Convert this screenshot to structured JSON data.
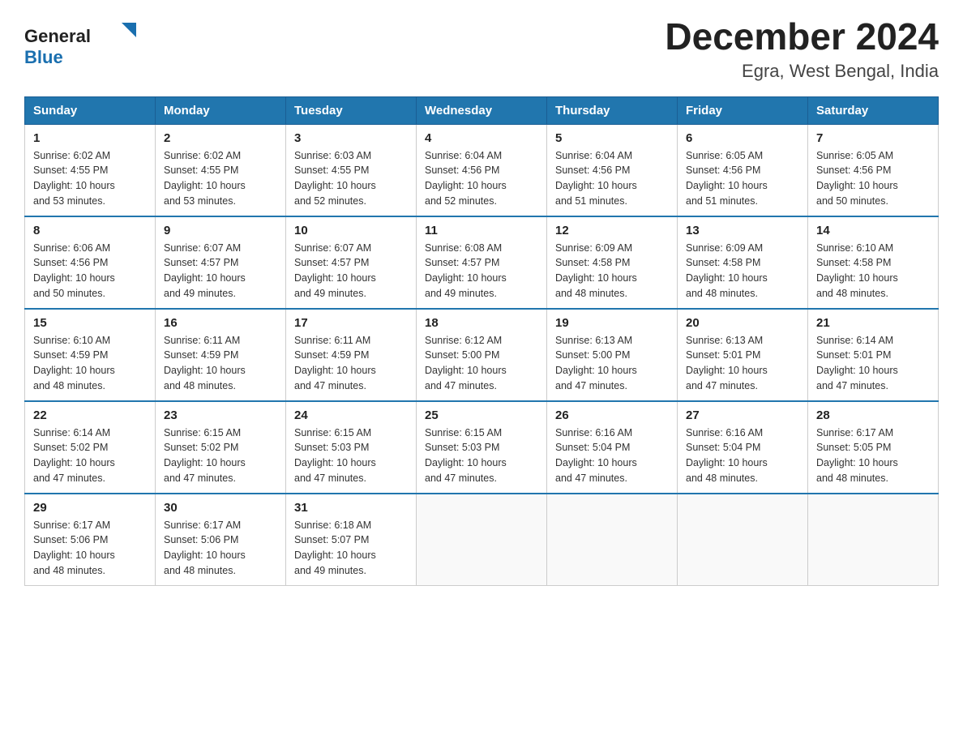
{
  "header": {
    "logo_general": "General",
    "logo_blue": "Blue",
    "month_title": "December 2024",
    "location": "Egra, West Bengal, India"
  },
  "days_of_week": [
    "Sunday",
    "Monday",
    "Tuesday",
    "Wednesday",
    "Thursday",
    "Friday",
    "Saturday"
  ],
  "weeks": [
    [
      {
        "day": "1",
        "sunrise": "6:02 AM",
        "sunset": "4:55 PM",
        "daylight": "10 hours and 53 minutes."
      },
      {
        "day": "2",
        "sunrise": "6:02 AM",
        "sunset": "4:55 PM",
        "daylight": "10 hours and 53 minutes."
      },
      {
        "day": "3",
        "sunrise": "6:03 AM",
        "sunset": "4:55 PM",
        "daylight": "10 hours and 52 minutes."
      },
      {
        "day": "4",
        "sunrise": "6:04 AM",
        "sunset": "4:56 PM",
        "daylight": "10 hours and 52 minutes."
      },
      {
        "day": "5",
        "sunrise": "6:04 AM",
        "sunset": "4:56 PM",
        "daylight": "10 hours and 51 minutes."
      },
      {
        "day": "6",
        "sunrise": "6:05 AM",
        "sunset": "4:56 PM",
        "daylight": "10 hours and 51 minutes."
      },
      {
        "day": "7",
        "sunrise": "6:05 AM",
        "sunset": "4:56 PM",
        "daylight": "10 hours and 50 minutes."
      }
    ],
    [
      {
        "day": "8",
        "sunrise": "6:06 AM",
        "sunset": "4:56 PM",
        "daylight": "10 hours and 50 minutes."
      },
      {
        "day": "9",
        "sunrise": "6:07 AM",
        "sunset": "4:57 PM",
        "daylight": "10 hours and 49 minutes."
      },
      {
        "day": "10",
        "sunrise": "6:07 AM",
        "sunset": "4:57 PM",
        "daylight": "10 hours and 49 minutes."
      },
      {
        "day": "11",
        "sunrise": "6:08 AM",
        "sunset": "4:57 PM",
        "daylight": "10 hours and 49 minutes."
      },
      {
        "day": "12",
        "sunrise": "6:09 AM",
        "sunset": "4:58 PM",
        "daylight": "10 hours and 48 minutes."
      },
      {
        "day": "13",
        "sunrise": "6:09 AM",
        "sunset": "4:58 PM",
        "daylight": "10 hours and 48 minutes."
      },
      {
        "day": "14",
        "sunrise": "6:10 AM",
        "sunset": "4:58 PM",
        "daylight": "10 hours and 48 minutes."
      }
    ],
    [
      {
        "day": "15",
        "sunrise": "6:10 AM",
        "sunset": "4:59 PM",
        "daylight": "10 hours and 48 minutes."
      },
      {
        "day": "16",
        "sunrise": "6:11 AM",
        "sunset": "4:59 PM",
        "daylight": "10 hours and 48 minutes."
      },
      {
        "day": "17",
        "sunrise": "6:11 AM",
        "sunset": "4:59 PM",
        "daylight": "10 hours and 47 minutes."
      },
      {
        "day": "18",
        "sunrise": "6:12 AM",
        "sunset": "5:00 PM",
        "daylight": "10 hours and 47 minutes."
      },
      {
        "day": "19",
        "sunrise": "6:13 AM",
        "sunset": "5:00 PM",
        "daylight": "10 hours and 47 minutes."
      },
      {
        "day": "20",
        "sunrise": "6:13 AM",
        "sunset": "5:01 PM",
        "daylight": "10 hours and 47 minutes."
      },
      {
        "day": "21",
        "sunrise": "6:14 AM",
        "sunset": "5:01 PM",
        "daylight": "10 hours and 47 minutes."
      }
    ],
    [
      {
        "day": "22",
        "sunrise": "6:14 AM",
        "sunset": "5:02 PM",
        "daylight": "10 hours and 47 minutes."
      },
      {
        "day": "23",
        "sunrise": "6:15 AM",
        "sunset": "5:02 PM",
        "daylight": "10 hours and 47 minutes."
      },
      {
        "day": "24",
        "sunrise": "6:15 AM",
        "sunset": "5:03 PM",
        "daylight": "10 hours and 47 minutes."
      },
      {
        "day": "25",
        "sunrise": "6:15 AM",
        "sunset": "5:03 PM",
        "daylight": "10 hours and 47 minutes."
      },
      {
        "day": "26",
        "sunrise": "6:16 AM",
        "sunset": "5:04 PM",
        "daylight": "10 hours and 47 minutes."
      },
      {
        "day": "27",
        "sunrise": "6:16 AM",
        "sunset": "5:04 PM",
        "daylight": "10 hours and 48 minutes."
      },
      {
        "day": "28",
        "sunrise": "6:17 AM",
        "sunset": "5:05 PM",
        "daylight": "10 hours and 48 minutes."
      }
    ],
    [
      {
        "day": "29",
        "sunrise": "6:17 AM",
        "sunset": "5:06 PM",
        "daylight": "10 hours and 48 minutes."
      },
      {
        "day": "30",
        "sunrise": "6:17 AM",
        "sunset": "5:06 PM",
        "daylight": "10 hours and 48 minutes."
      },
      {
        "day": "31",
        "sunrise": "6:18 AM",
        "sunset": "5:07 PM",
        "daylight": "10 hours and 49 minutes."
      },
      null,
      null,
      null,
      null
    ]
  ],
  "labels": {
    "sunrise": "Sunrise:",
    "sunset": "Sunset:",
    "daylight": "Daylight:"
  }
}
